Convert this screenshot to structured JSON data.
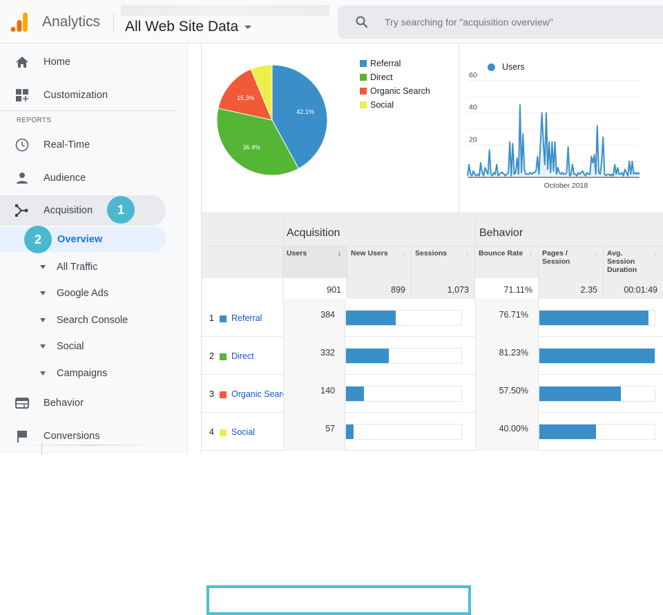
{
  "header": {
    "app_name": "Analytics",
    "property": "All Web Site Data",
    "search_placeholder": "Try searching for \"acquisition overview\""
  },
  "sidebar": {
    "home": "Home",
    "customization": "Customization",
    "reports_label": "REPORTS",
    "realtime": "Real-Time",
    "audience": "Audience",
    "acquisition": "Acquisition",
    "overview": "Overview",
    "sub_items": [
      "All Traffic",
      "Google Ads",
      "Search Console",
      "Social",
      "Campaigns"
    ],
    "behavior": "Behavior",
    "conversions": "Conversions",
    "badges": [
      "1",
      "2"
    ]
  },
  "colors": {
    "referral": "#3a8fc9",
    "direct": "#55b534",
    "organic": "#f05a37",
    "social": "#ecf04c",
    "accent": "#1a73e8",
    "badge": "#4bb8d0"
  },
  "chart_data": [
    {
      "type": "pie",
      "title": "",
      "categories": [
        "Referral",
        "Direct",
        "Organic Search",
        "Social"
      ],
      "values": [
        42.1,
        36.4,
        15.3,
        6.3
      ],
      "labels": [
        "42.1%",
        "36.4%",
        "15.3%",
        ""
      ],
      "colors": [
        "#3a8fc9",
        "#55b534",
        "#f05a37",
        "#ecf04c"
      ],
      "legend": "right"
    },
    {
      "type": "line",
      "title": "",
      "series": [
        {
          "name": "Users",
          "values": [
            1,
            8,
            2,
            1,
            4,
            2,
            1,
            2,
            1,
            9,
            3,
            1,
            6,
            4,
            2,
            17,
            2,
            1,
            3,
            2,
            8,
            1,
            2,
            3,
            3,
            2,
            1,
            2,
            3,
            22,
            1,
            21,
            2,
            3,
            12,
            2,
            45,
            3,
            27,
            5,
            2,
            2,
            2,
            3,
            2,
            3,
            3,
            4,
            13,
            2,
            20,
            40,
            22,
            8,
            40,
            5,
            22,
            3,
            22,
            4,
            22,
            2,
            6,
            3,
            2,
            3,
            2,
            2,
            3,
            19,
            1,
            2,
            8,
            2,
            2,
            1,
            3,
            2,
            3,
            4,
            2,
            1,
            3,
            2,
            2,
            13,
            9,
            14,
            2,
            32,
            3,
            2,
            10,
            25,
            2,
            1,
            2,
            2,
            1,
            2,
            1,
            8,
            2,
            6,
            2,
            2,
            3,
            1,
            5,
            3,
            1,
            10,
            2,
            10,
            2,
            3,
            2,
            3,
            2
          ]
        }
      ],
      "xlabel": "October 2018",
      "ylabel": "",
      "yticks": [
        20,
        40,
        60
      ],
      "ylim": [
        0,
        60
      ],
      "grid": true,
      "legend": "top-left"
    }
  ],
  "table": {
    "groups": [
      "Acquisition",
      "Behavior"
    ],
    "columns": [
      "Users",
      "New Users",
      "Sessions",
      "Bounce Rate",
      "Pages / Session",
      "Avg. Session Duration"
    ],
    "sort_arrow": "↓",
    "totals": [
      "901",
      "899",
      "1,073",
      "71.11%",
      "2.35",
      "00:01:49"
    ],
    "rows": [
      {
        "rank": "1",
        "channel": "Referral",
        "users": "384",
        "users_share": 0.421,
        "bounce_rate": "76.71%",
        "bounce_share": 0.944
      },
      {
        "rank": "2",
        "channel": "Direct",
        "users": "332",
        "users_share": 0.364,
        "bounce_rate": "81.23%",
        "bounce_share": 1.0
      },
      {
        "rank": "3",
        "channel": "Organic Search",
        "users": "140",
        "users_share": 0.153,
        "bounce_rate": "57.50%",
        "bounce_share": 0.708
      },
      {
        "rank": "4",
        "channel": "Social",
        "users": "57",
        "users_share": 0.063,
        "bounce_rate": "40.00%",
        "bounce_share": 0.492
      }
    ]
  }
}
